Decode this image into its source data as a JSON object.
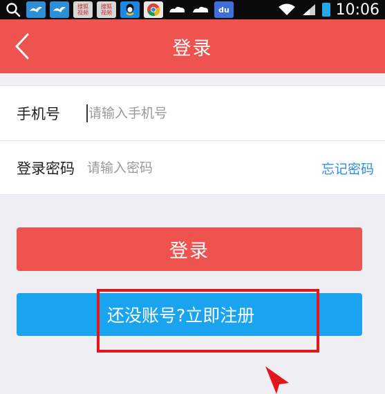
{
  "status_bar": {
    "icons": [
      "search-icon",
      "bird-app-icon",
      "bird-app-icon",
      "video-app-icon",
      "video-app-icon",
      "qq-icon",
      "chrome-icon",
      "cloud-icon",
      "cloud-icon",
      "baidu-icon",
      "wifi-icon",
      "signal-icon",
      "battery-icon"
    ],
    "video_icon_label_top": "搜狐",
    "video_icon_label_bottom": "视频",
    "baidu_label": "du",
    "time": "10:06"
  },
  "header": {
    "title": "登录",
    "back_icon": "back-arrow-icon"
  },
  "form": {
    "phone": {
      "label": "手机号",
      "placeholder": "请输入手机号"
    },
    "password": {
      "label": "登录密码",
      "placeholder": "请输入密码",
      "forgot_label": "忘记密码"
    }
  },
  "actions": {
    "login_label": "登录",
    "register_label": "还没账号?立即注册"
  },
  "colors": {
    "header_bg": "#ef5350",
    "login_bg": "#ef5350",
    "register_bg": "#1aa4f0",
    "link": "#2b8fe8",
    "highlight": "#e3161c"
  }
}
